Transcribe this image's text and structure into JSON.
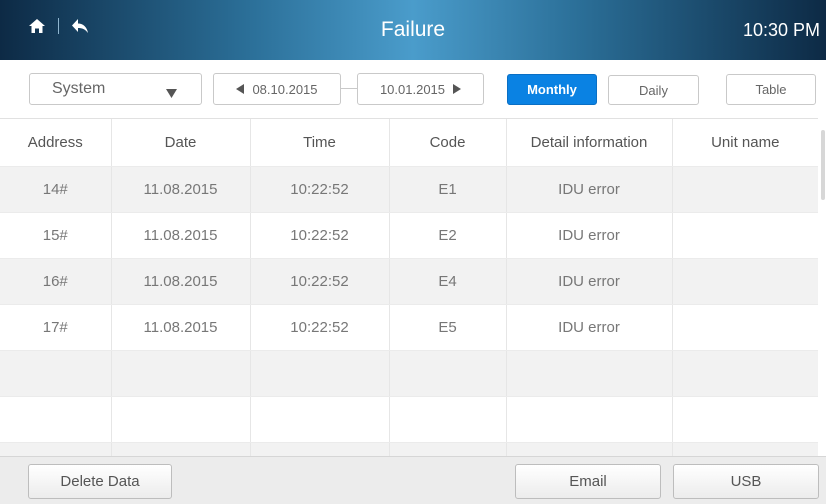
{
  "header": {
    "title": "Failure",
    "time": "10:30 PM"
  },
  "toolbar": {
    "system_select": "System",
    "date_from": "08.10.2015",
    "date_to": "10.01.2015",
    "monthly_label": "Monthly",
    "daily_label": "Daily",
    "table_label": "Table"
  },
  "table": {
    "columns": [
      "Address",
      "Date",
      "Time",
      "Code",
      "Detail information",
      "Unit name"
    ],
    "rows": [
      [
        "14#",
        "11.08.2015",
        "10:22:52",
        "E1",
        "IDU error",
        ""
      ],
      [
        "15#",
        "11.08.2015",
        "10:22:52",
        "E2",
        "IDU error",
        ""
      ],
      [
        "16#",
        "11.08.2015",
        "10:22:52",
        "E4",
        "IDU error",
        ""
      ],
      [
        "17#",
        "11.08.2015",
        "10:22:52",
        "E5",
        "IDU error",
        ""
      ],
      [
        "",
        "",
        "",
        "",
        "",
        ""
      ],
      [
        "",
        "",
        "",
        "",
        "",
        ""
      ],
      [
        "",
        "",
        "",
        "",
        "",
        ""
      ]
    ]
  },
  "footer": {
    "delete_label": "Delete Data",
    "email_label": "Email",
    "usb_label": "USB"
  },
  "colors": {
    "accent": "#0a82e3",
    "header_dark": "#0d2a45",
    "header_light": "#4a9ccb"
  }
}
